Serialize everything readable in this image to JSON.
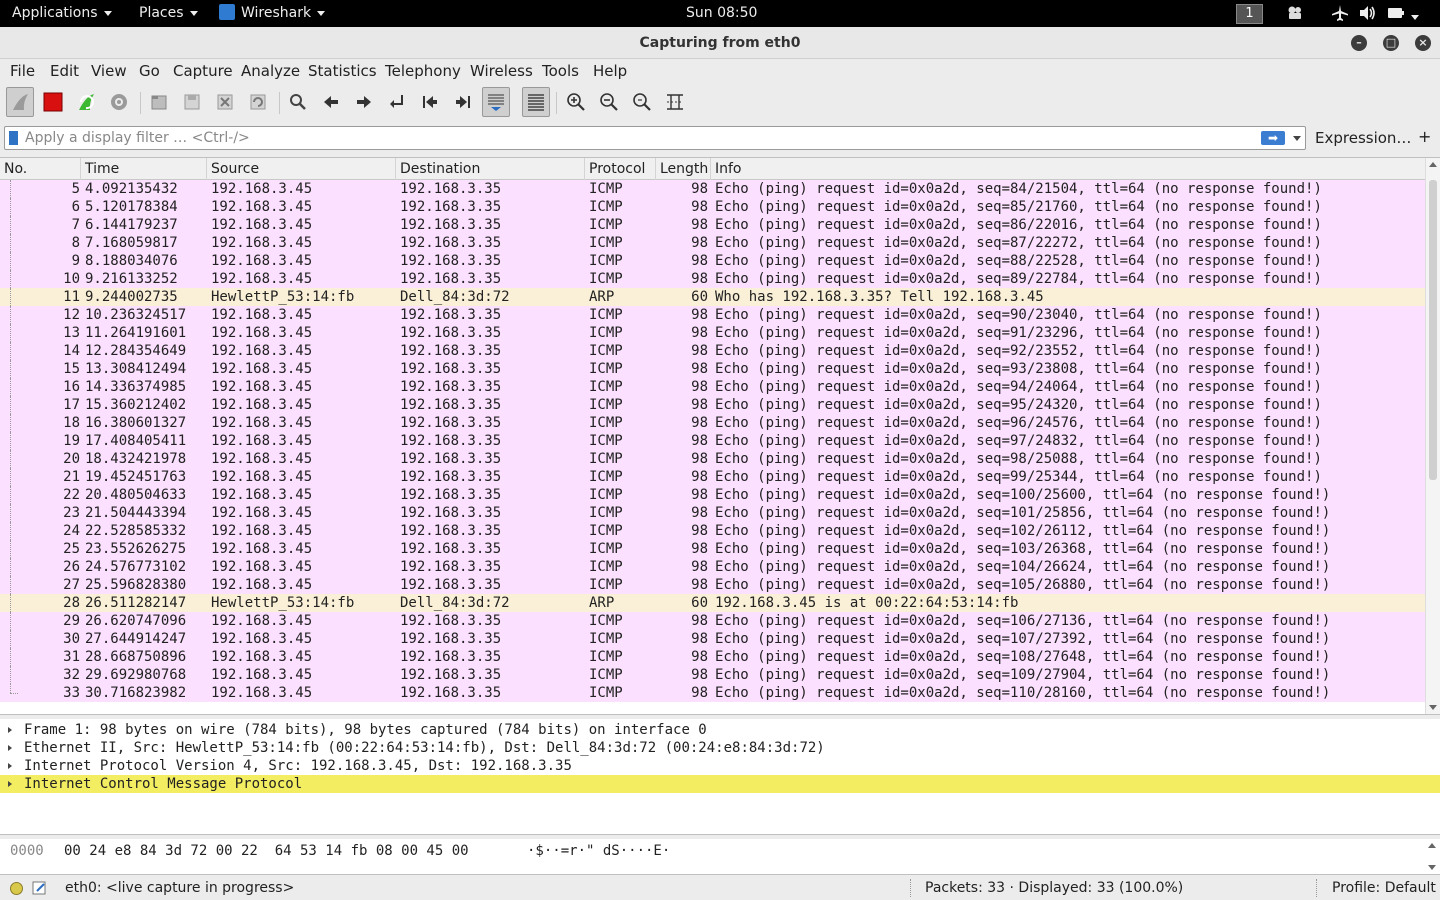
{
  "topbar": {
    "applications": "Applications",
    "places": "Places",
    "app_name": "Wireshark",
    "clock": "Sun 08:50",
    "workspace": "1"
  },
  "window": {
    "title": "Capturing from eth0"
  },
  "menu": [
    "File",
    "Edit",
    "View",
    "Go",
    "Capture",
    "Analyze",
    "Statistics",
    "Telephony",
    "Wireless",
    "Tools",
    "Help"
  ],
  "toolbar_icons": [
    "shark-fin-start-icon",
    "stop-capture-icon",
    "restart-capture-icon",
    "capture-options-icon",
    "open-file-icon",
    "save-file-icon",
    "close-file-icon",
    "reload-file-icon",
    "find-packet-icon",
    "go-back-icon",
    "go-forward-icon",
    "go-to-packet-icon",
    "first-packet-icon",
    "last-packet-icon",
    "autoscroll-icon",
    "colorize-icon",
    "zoom-in-icon",
    "zoom-out-icon",
    "normal-size-icon",
    "resize-columns-icon"
  ],
  "filter": {
    "placeholder": "Apply a display filter … <Ctrl-/>",
    "value": "",
    "expression_label": "Expression…",
    "add_label": "+"
  },
  "columns": [
    "No.",
    "Time",
    "Source",
    "Destination",
    "Protocol",
    "Length",
    "Info"
  ],
  "colors": {
    "icmp_row": "#fce0ff",
    "arp_row": "#faf0d7",
    "selected_detail": "#f3ee61"
  },
  "packets": [
    {
      "no": "5",
      "time": "4.092135432",
      "src": "192.168.3.45",
      "dst": "192.168.3.35",
      "proto": "ICMP",
      "len": "98",
      "info": "Echo (ping) request  id=0x0a2d, seq=84/21504, ttl=64 (no response found!)"
    },
    {
      "no": "6",
      "time": "5.120178384",
      "src": "192.168.3.45",
      "dst": "192.168.3.35",
      "proto": "ICMP",
      "len": "98",
      "info": "Echo (ping) request  id=0x0a2d, seq=85/21760, ttl=64 (no response found!)"
    },
    {
      "no": "7",
      "time": "6.144179237",
      "src": "192.168.3.45",
      "dst": "192.168.3.35",
      "proto": "ICMP",
      "len": "98",
      "info": "Echo (ping) request  id=0x0a2d, seq=86/22016, ttl=64 (no response found!)"
    },
    {
      "no": "8",
      "time": "7.168059817",
      "src": "192.168.3.45",
      "dst": "192.168.3.35",
      "proto": "ICMP",
      "len": "98",
      "info": "Echo (ping) request  id=0x0a2d, seq=87/22272, ttl=64 (no response found!)"
    },
    {
      "no": "9",
      "time": "8.188034076",
      "src": "192.168.3.45",
      "dst": "192.168.3.35",
      "proto": "ICMP",
      "len": "98",
      "info": "Echo (ping) request  id=0x0a2d, seq=88/22528, ttl=64 (no response found!)"
    },
    {
      "no": "10",
      "time": "9.216133252",
      "src": "192.168.3.45",
      "dst": "192.168.3.35",
      "proto": "ICMP",
      "len": "98",
      "info": "Echo (ping) request  id=0x0a2d, seq=89/22784, ttl=64 (no response found!)"
    },
    {
      "no": "11",
      "time": "9.244002735",
      "src": "HewlettP_53:14:fb",
      "dst": "Dell_84:3d:72",
      "proto": "ARP",
      "len": "60",
      "info": "Who has 192.168.3.35? Tell 192.168.3.45"
    },
    {
      "no": "12",
      "time": "10.236324517",
      "src": "192.168.3.45",
      "dst": "192.168.3.35",
      "proto": "ICMP",
      "len": "98",
      "info": "Echo (ping) request  id=0x0a2d, seq=90/23040, ttl=64 (no response found!)"
    },
    {
      "no": "13",
      "time": "11.264191601",
      "src": "192.168.3.45",
      "dst": "192.168.3.35",
      "proto": "ICMP",
      "len": "98",
      "info": "Echo (ping) request  id=0x0a2d, seq=91/23296, ttl=64 (no response found!)"
    },
    {
      "no": "14",
      "time": "12.284354649",
      "src": "192.168.3.45",
      "dst": "192.168.3.35",
      "proto": "ICMP",
      "len": "98",
      "info": "Echo (ping) request  id=0x0a2d, seq=92/23552, ttl=64 (no response found!)"
    },
    {
      "no": "15",
      "time": "13.308412494",
      "src": "192.168.3.45",
      "dst": "192.168.3.35",
      "proto": "ICMP",
      "len": "98",
      "info": "Echo (ping) request  id=0x0a2d, seq=93/23808, ttl=64 (no response found!)"
    },
    {
      "no": "16",
      "time": "14.336374985",
      "src": "192.168.3.45",
      "dst": "192.168.3.35",
      "proto": "ICMP",
      "len": "98",
      "info": "Echo (ping) request  id=0x0a2d, seq=94/24064, ttl=64 (no response found!)"
    },
    {
      "no": "17",
      "time": "15.360212402",
      "src": "192.168.3.45",
      "dst": "192.168.3.35",
      "proto": "ICMP",
      "len": "98",
      "info": "Echo (ping) request  id=0x0a2d, seq=95/24320, ttl=64 (no response found!)"
    },
    {
      "no": "18",
      "time": "16.380601327",
      "src": "192.168.3.45",
      "dst": "192.168.3.35",
      "proto": "ICMP",
      "len": "98",
      "info": "Echo (ping) request  id=0x0a2d, seq=96/24576, ttl=64 (no response found!)"
    },
    {
      "no": "19",
      "time": "17.408405411",
      "src": "192.168.3.45",
      "dst": "192.168.3.35",
      "proto": "ICMP",
      "len": "98",
      "info": "Echo (ping) request  id=0x0a2d, seq=97/24832, ttl=64 (no response found!)"
    },
    {
      "no": "20",
      "time": "18.432421978",
      "src": "192.168.3.45",
      "dst": "192.168.3.35",
      "proto": "ICMP",
      "len": "98",
      "info": "Echo (ping) request  id=0x0a2d, seq=98/25088, ttl=64 (no response found!)"
    },
    {
      "no": "21",
      "time": "19.452451763",
      "src": "192.168.3.45",
      "dst": "192.168.3.35",
      "proto": "ICMP",
      "len": "98",
      "info": "Echo (ping) request  id=0x0a2d, seq=99/25344, ttl=64 (no response found!)"
    },
    {
      "no": "22",
      "time": "20.480504633",
      "src": "192.168.3.45",
      "dst": "192.168.3.35",
      "proto": "ICMP",
      "len": "98",
      "info": "Echo (ping) request  id=0x0a2d, seq=100/25600, ttl=64 (no response found!)"
    },
    {
      "no": "23",
      "time": "21.504443394",
      "src": "192.168.3.45",
      "dst": "192.168.3.35",
      "proto": "ICMP",
      "len": "98",
      "info": "Echo (ping) request  id=0x0a2d, seq=101/25856, ttl=64 (no response found!)"
    },
    {
      "no": "24",
      "time": "22.528585332",
      "src": "192.168.3.45",
      "dst": "192.168.3.35",
      "proto": "ICMP",
      "len": "98",
      "info": "Echo (ping) request  id=0x0a2d, seq=102/26112, ttl=64 (no response found!)"
    },
    {
      "no": "25",
      "time": "23.552626275",
      "src": "192.168.3.45",
      "dst": "192.168.3.35",
      "proto": "ICMP",
      "len": "98",
      "info": "Echo (ping) request  id=0x0a2d, seq=103/26368, ttl=64 (no response found!)"
    },
    {
      "no": "26",
      "time": "24.576773102",
      "src": "192.168.3.45",
      "dst": "192.168.3.35",
      "proto": "ICMP",
      "len": "98",
      "info": "Echo (ping) request  id=0x0a2d, seq=104/26624, ttl=64 (no response found!)"
    },
    {
      "no": "27",
      "time": "25.596828380",
      "src": "192.168.3.45",
      "dst": "192.168.3.35",
      "proto": "ICMP",
      "len": "98",
      "info": "Echo (ping) request  id=0x0a2d, seq=105/26880, ttl=64 (no response found!)"
    },
    {
      "no": "28",
      "time": "26.511282147",
      "src": "HewlettP_53:14:fb",
      "dst": "Dell_84:3d:72",
      "proto": "ARP",
      "len": "60",
      "info": "192.168.3.45 is at 00:22:64:53:14:fb"
    },
    {
      "no": "29",
      "time": "26.620747096",
      "src": "192.168.3.45",
      "dst": "192.168.3.35",
      "proto": "ICMP",
      "len": "98",
      "info": "Echo (ping) request  id=0x0a2d, seq=106/27136, ttl=64 (no response found!)"
    },
    {
      "no": "30",
      "time": "27.644914247",
      "src": "192.168.3.45",
      "dst": "192.168.3.35",
      "proto": "ICMP",
      "len": "98",
      "info": "Echo (ping) request  id=0x0a2d, seq=107/27392, ttl=64 (no response found!)"
    },
    {
      "no": "31",
      "time": "28.668750896",
      "src": "192.168.3.45",
      "dst": "192.168.3.35",
      "proto": "ICMP",
      "len": "98",
      "info": "Echo (ping) request  id=0x0a2d, seq=108/27648, ttl=64 (no response found!)"
    },
    {
      "no": "32",
      "time": "29.692980768",
      "src": "192.168.3.45",
      "dst": "192.168.3.35",
      "proto": "ICMP",
      "len": "98",
      "info": "Echo (ping) request  id=0x0a2d, seq=109/27904, ttl=64 (no response found!)"
    },
    {
      "no": "33",
      "time": "30.716823982",
      "src": "192.168.3.45",
      "dst": "192.168.3.35",
      "proto": "ICMP",
      "len": "98",
      "info": "Echo (ping) request  id=0x0a2d, seq=110/28160, ttl=64 (no response found!)"
    }
  ],
  "details": [
    {
      "text": "Frame 1: 98 bytes on wire (784 bits), 98 bytes captured (784 bits) on interface 0",
      "selected": false
    },
    {
      "text": "Ethernet II, Src: HewlettP_53:14:fb (00:22:64:53:14:fb), Dst: Dell_84:3d:72 (00:24:e8:84:3d:72)",
      "selected": false
    },
    {
      "text": "Internet Protocol Version 4, Src: 192.168.3.45, Dst: 192.168.3.35",
      "selected": false
    },
    {
      "text": "Internet Control Message Protocol",
      "selected": true
    }
  ],
  "bytes": {
    "offset": "0000",
    "hex": "00 24 e8 84 3d 72 00 22  64 53 14 fb 08 00 45 00",
    "ascii": "·$··=r·\" dS····E·"
  },
  "status": {
    "interface": "eth0: <live capture in progress>",
    "packets": "Packets: 33 · Displayed: 33 (100.0%)",
    "profile": "Profile: Default"
  }
}
